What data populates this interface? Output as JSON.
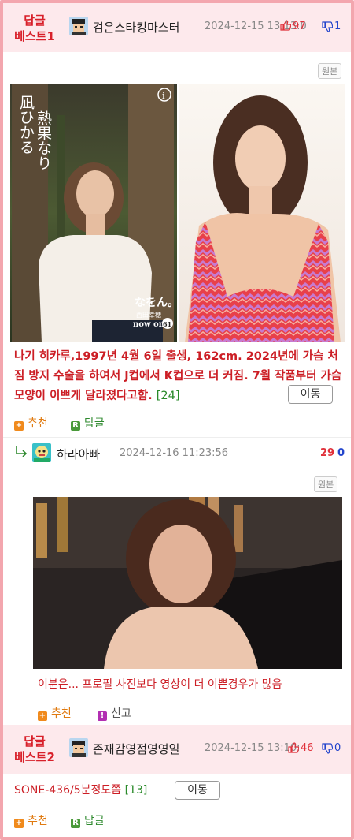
{
  "post1": {
    "badge_line1": "답글",
    "badge_line2": "베스트1",
    "author": "검은스타킹마스터",
    "date": "2024-12-15 13:13:0",
    "score_text": "97",
    "likes": "97",
    "dislikes": "1",
    "original_label": "원본",
    "image_left_text": "熟果なり 凪ひかる",
    "image_left_logo": "なをん。",
    "image_left_logo_sub": "now on",
    "image_left_number": "61",
    "body": "나기 히카루,1997년 4월 6일 출생, 162cm. 2024년에 가슴 처짐 방지 수술을 하여서 J컵에서 K컵으로 더 커짐. 7월 작품부터 가슴 모양이 이쁘게 달라졌다고함.",
    "comment_count": "[24]",
    "move_label": "이동",
    "recommend_label": "추천",
    "reply_label": "답글"
  },
  "reply1": {
    "author": "하라아빠",
    "date": "2024-12-16 11:23:56",
    "likes": "29",
    "dislikes": "0",
    "original_label": "원본",
    "caption": "이분은... 프로필 사진보다 영상이 더 이쁜경우가 많음",
    "recommend_label": "추천",
    "report_label": "신고"
  },
  "post2": {
    "badge_line1": "답글",
    "badge_line2": "베스트2",
    "author": "존재감영점영영일",
    "date": "2024-12-15 13:10:",
    "likes": "46",
    "dislikes": "0",
    "title": "SONE-436/5분정도쯤",
    "comment_count": "[13]",
    "move_label": "이동",
    "recommend_label": "추천",
    "reply_label": "답글"
  },
  "colors": {
    "border": "#f3a6ae",
    "header_bg": "#fde9ec",
    "badge_red": "#d8202a",
    "body_red": "#cc1e25",
    "like_red": "#e0303a",
    "dislike_blue": "#2244cc",
    "recommend_orange": "#e07a10",
    "reply_green": "#2f8a2f"
  },
  "icons": {
    "thumb_up": "thumb-up-icon",
    "thumb_down": "thumb-down-icon",
    "reply_arrow": "reply-arrow-icon",
    "plus": "plus-icon",
    "reply_r": "reply-r-icon",
    "report": "report-icon",
    "info": "info-icon"
  }
}
